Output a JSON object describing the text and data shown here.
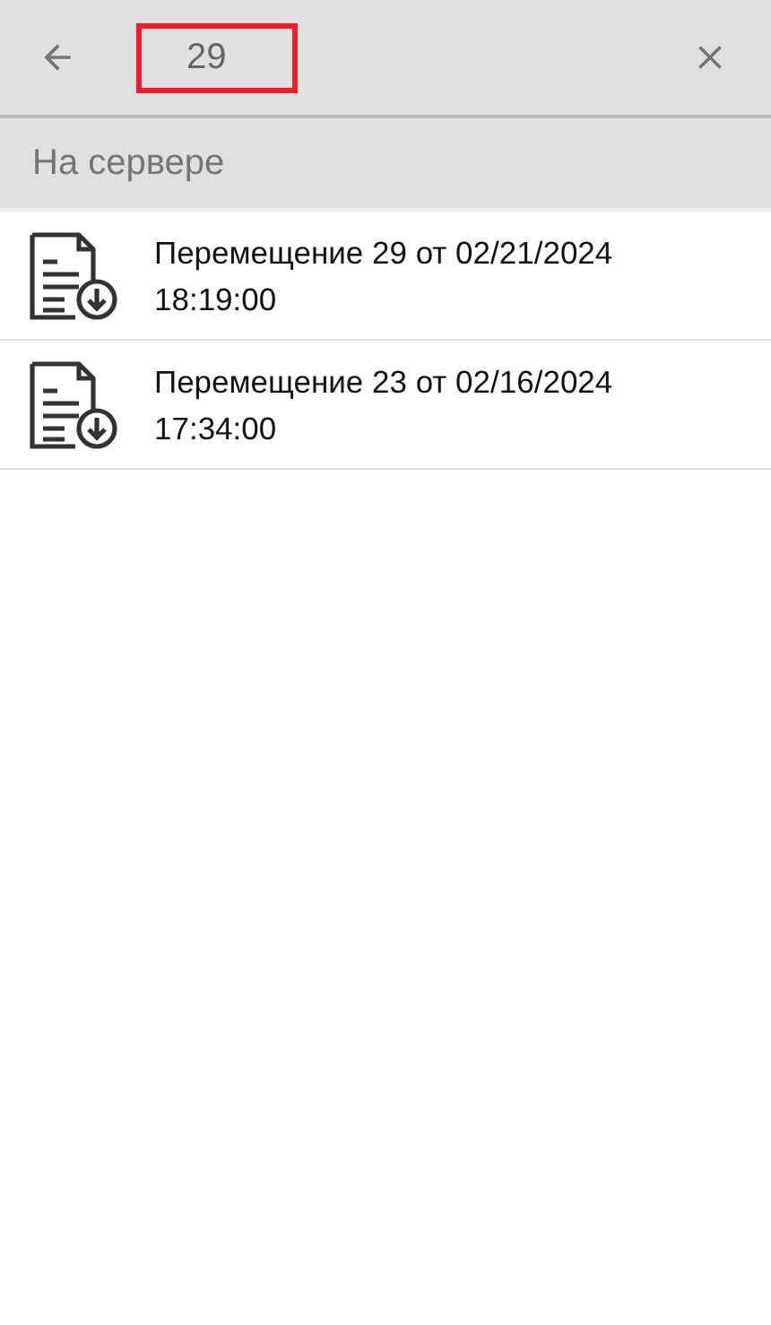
{
  "toolbar": {
    "search": {
      "value": "29",
      "highlighted": true
    }
  },
  "section": {
    "title": "На сервере"
  },
  "items": [
    {
      "title": "Перемещение 29 от 02/21/2024",
      "time": "18:19:00"
    },
    {
      "title": "Перемещение 23 от 02/16/2024",
      "time": "17:34:00"
    }
  ]
}
